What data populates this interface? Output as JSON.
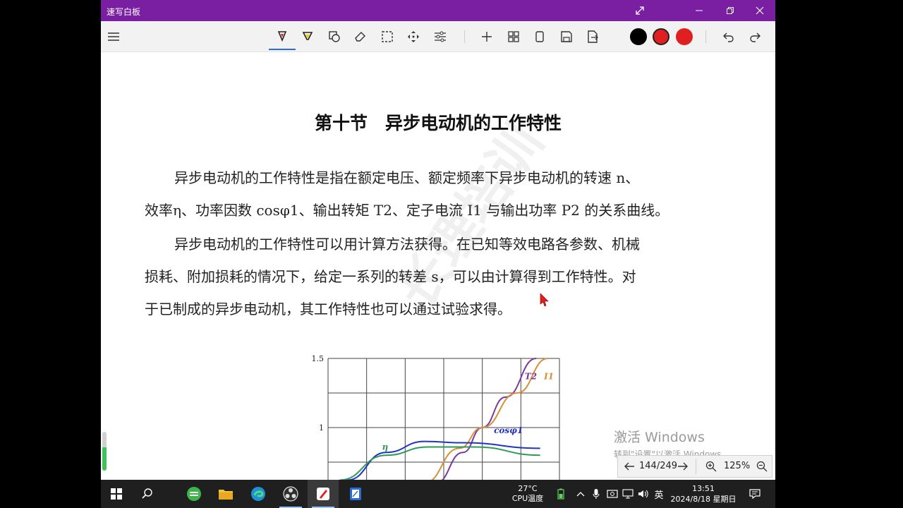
{
  "window": {
    "title": "速写白板"
  },
  "toolbar": {
    "colors": [
      "#000000",
      "#e02020",
      "#e02020"
    ]
  },
  "document": {
    "heading": "第十节　异步电动机的工作特性",
    "para1": [
      "异步电动机的工作特性是指在额定电压、额定频率下异步电动机的转速 n、",
      "效率η、功率因数 cosφ1、输出转矩 T2、定子电流 I1 与输出功率 P2 的关系曲线。"
    ],
    "para2": [
      "异步电动机的工作特性可以用计算方法获得。在已知等效电路各参数、机械",
      "损耗、附加损耗的情况下，给定一系列的转差 s，可以由计算得到工作特性。对",
      "于已制成的异步电动机，其工作特性也可以通过试验求得。"
    ],
    "watermark": "长理培训"
  },
  "chart_data": {
    "type": "line",
    "yticks": [
      "1.5",
      "1"
    ],
    "ylim": [
      0.7,
      1.5
    ],
    "xlim": [
      0,
      6
    ],
    "grid": true,
    "series": [
      {
        "name": "T2",
        "color": "#7a3a9a",
        "x": [
          2.8,
          3.5,
          4.0,
          4.6,
          5.4
        ],
        "y": [
          0.6,
          0.82,
          1.0,
          1.22,
          1.5
        ]
      },
      {
        "name": "I1",
        "color": "#d98e3a",
        "x": [
          2.5,
          3.4,
          4.0,
          4.9,
          5.7
        ],
        "y": [
          0.6,
          0.85,
          1.0,
          1.25,
          1.5
        ]
      },
      {
        "name": "cosφ1",
        "color": "#2233c8",
        "x": [
          0.5,
          1.5,
          2.5,
          3.5,
          5.5
        ],
        "y": [
          0.62,
          0.82,
          0.9,
          0.89,
          0.85
        ]
      },
      {
        "name": "η",
        "color": "#2e9a5a",
        "x": [
          0.3,
          1.5,
          2.6,
          3.8,
          5.5
        ],
        "y": [
          0.62,
          0.8,
          0.86,
          0.86,
          0.8
        ]
      }
    ]
  },
  "activation": {
    "line1": "激活 Windows",
    "line2": "转到\"设置\"以激活 Windows。"
  },
  "pager": {
    "page": "144/249",
    "zoom": "125%"
  },
  "taskbar": {
    "temp": "27°C",
    "cpu": "CPU温度",
    "ime": "英",
    "time": "13:51",
    "date": "2024/8/18 星期日"
  }
}
